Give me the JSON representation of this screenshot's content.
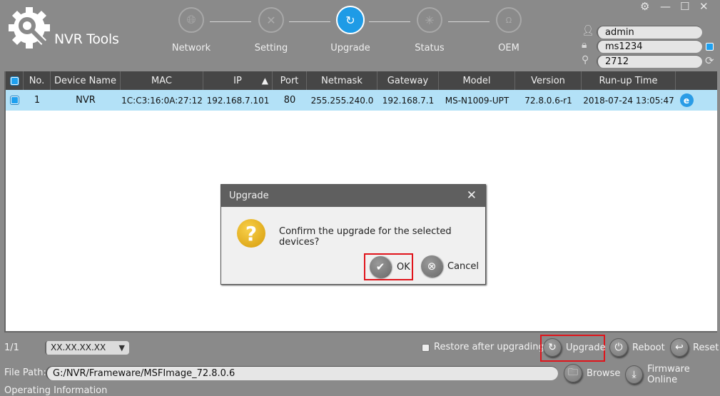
{
  "app": {
    "title": "NVR Tools"
  },
  "nav": {
    "steps": [
      {
        "label": "Network",
        "icon": "globe-icon",
        "active": false
      },
      {
        "label": "Setting",
        "icon": "tools-icon",
        "active": false
      },
      {
        "label": "Upgrade",
        "icon": "upgrade-icon",
        "active": true
      },
      {
        "label": "Status",
        "icon": "status-icon",
        "active": false
      },
      {
        "label": "OEM",
        "icon": "oem-icon",
        "active": false
      }
    ]
  },
  "window_controls": {
    "settings": "⚙",
    "minimize": "—",
    "maximize": "☐",
    "close": "✕"
  },
  "login": {
    "username": "admin",
    "password": "ms1234",
    "search": "2712"
  },
  "table": {
    "columns": [
      "No.",
      "Device Name",
      "MAC",
      "IP",
      "Port",
      "Netmask",
      "Gateway",
      "Model",
      "Version",
      "Run-up Time"
    ],
    "sort_indicator": "▲",
    "rows": [
      {
        "no": "1",
        "device_name": "NVR",
        "mac": "1C:C3:16:0A:27:12",
        "ip": "192.168.7.101",
        "port": "80",
        "netmask": "255.255.240.0",
        "gateway": "192.168.7.1",
        "model": "MS-N1009-UPT",
        "version": "72.8.0.6-r1",
        "runup_time": "2018-07-24 13:05:47",
        "selected": true
      }
    ]
  },
  "dialog": {
    "title": "Upgrade",
    "message": "Confirm the upgrade for the selected devices?",
    "ok_label": "OK",
    "cancel_label": "Cancel"
  },
  "bottom": {
    "page_indicator": "1/1",
    "version_select": "XX.XX.XX.XX",
    "restore_label": "Restore after upgrading",
    "restore_checked": false,
    "upgrade_label": "Upgrade",
    "reboot_label": "Reboot",
    "reset_label": "Reset",
    "file_path_label": "File Path:",
    "file_path_value": "G:/NVR/Frameware/MSFImage_72.8.0.6",
    "browse_label": "Browse",
    "firmware_online_label": "Firmware Online",
    "operating_info_label": "Operating Information"
  },
  "colors": {
    "accent": "#1e9be6",
    "selected_row": "#b3e1f7",
    "highlight_box": "#e0141b",
    "header_bg": "#464646",
    "background": "#8a8a8a"
  }
}
